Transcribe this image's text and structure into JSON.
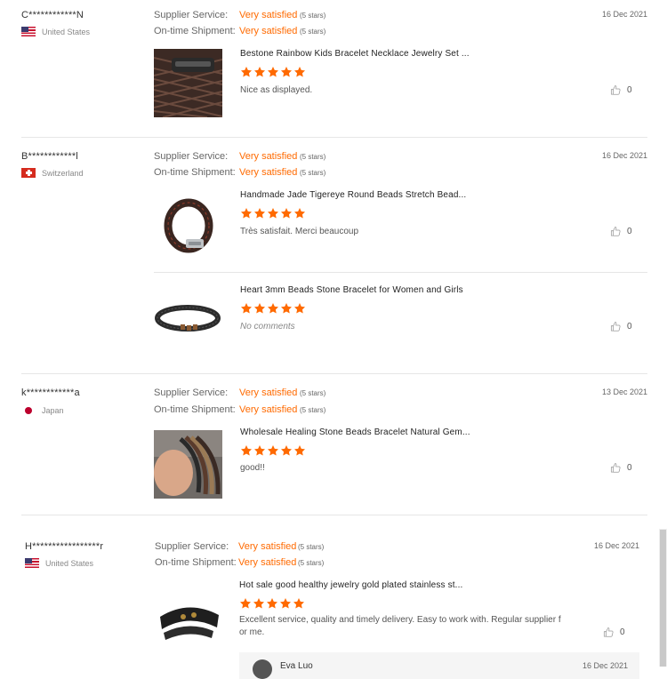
{
  "labels": {
    "supplier_service": "Supplier Service:",
    "ontime_shipment": "On-time Shipment:",
    "very_satisfied": "Very satisfied",
    "five_stars": "(5 stars)"
  },
  "colors": {
    "accent": "#ff6a00",
    "star": "#ff6a00"
  },
  "reviews": [
    {
      "buyer": "C************N",
      "country": "United States",
      "flag": "us-flag",
      "date": "16 Dec 2021",
      "products": [
        {
          "title": "Bestone Rainbow Kids Bracelet Necklace Jewelry Set ...",
          "rating": 5,
          "comment": "Nice as displayed.",
          "likes": "0"
        }
      ]
    },
    {
      "buyer": "B************l",
      "country": "Switzerland",
      "flag": "ch-flag",
      "date": "16 Dec 2021",
      "products": [
        {
          "title": "Handmade Jade Tigereye Round Beads Stretch Bead...",
          "rating": 5,
          "comment": "Très satisfait. Merci beaucoup",
          "likes": "0"
        },
        {
          "title": "Heart 3mm Beads Stone Bracelet for Women and Girls",
          "rating": 5,
          "comment": "No comments",
          "likes": "0"
        }
      ]
    },
    {
      "buyer": "k************a",
      "country": "Japan",
      "flag": "jp-flag",
      "date": "13 Dec 2021",
      "products": [
        {
          "title": "Wholesale Healing Stone Beads Bracelet Natural Gem...",
          "rating": 5,
          "comment": "good!!",
          "likes": "0"
        }
      ]
    },
    {
      "buyer": "H*****************r",
      "country": "United States",
      "flag": "us-flag",
      "date": "16 Dec 2021",
      "products": [
        {
          "title": "Hot sale good healthy jewelry gold plated stainless st...",
          "rating": 5,
          "comment_line1": "Excellent service, quality and timely delivery. Easy to work with. Regular supplier f",
          "comment_line2": "or me.",
          "likes": "0"
        }
      ],
      "reply": {
        "name": "Eva Luo",
        "date": "16 Dec 2021"
      }
    }
  ]
}
